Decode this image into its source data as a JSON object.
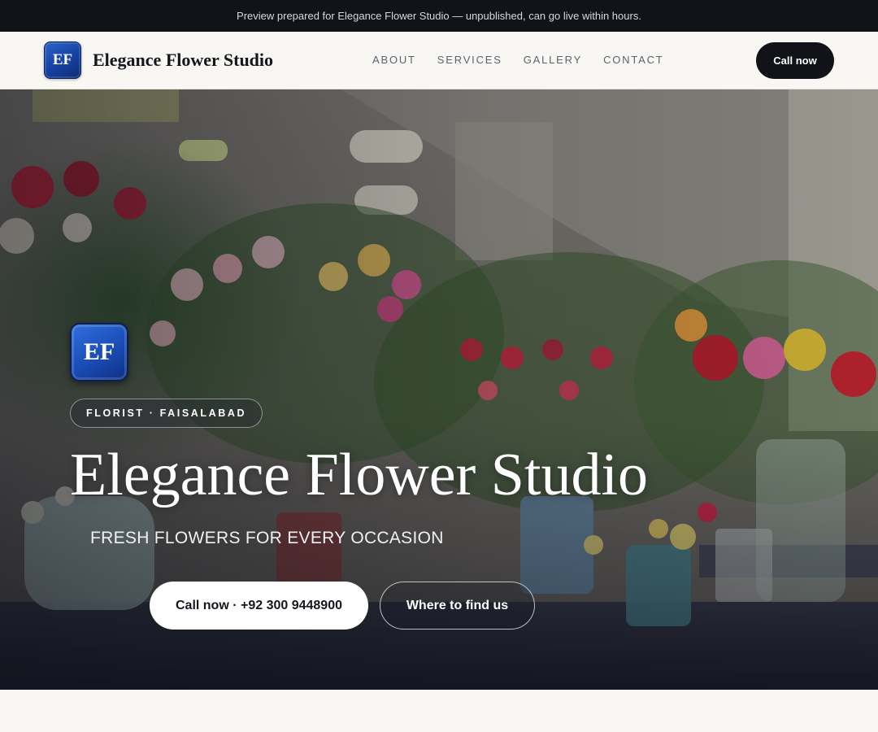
{
  "banner": {
    "text": "Preview prepared for Elegance Flower Studio — unpublished, can go live within hours."
  },
  "header": {
    "logo_initials": "EF",
    "brand_name": "Elegance Flower Studio",
    "nav": [
      {
        "label": "ABOUT"
      },
      {
        "label": "SERVICES"
      },
      {
        "label": "GALLERY"
      },
      {
        "label": "CONTACT"
      }
    ],
    "cta_label": "Call now"
  },
  "hero": {
    "logo_initials": "EF",
    "tag": "FLORIST · FAISALABAD",
    "title": "Elegance Flower Studio",
    "subtitle": "FRESH FLOWERS FOR EVERY OCCASION",
    "primary_button": "Call now · +92 300 9448900",
    "secondary_button": "Where to find us",
    "background_image": "flower-shop-photo"
  },
  "colors": {
    "dark": "#121319",
    "logo_blue": "#1a4cb5",
    "page_bg": "#f8f7f3"
  }
}
